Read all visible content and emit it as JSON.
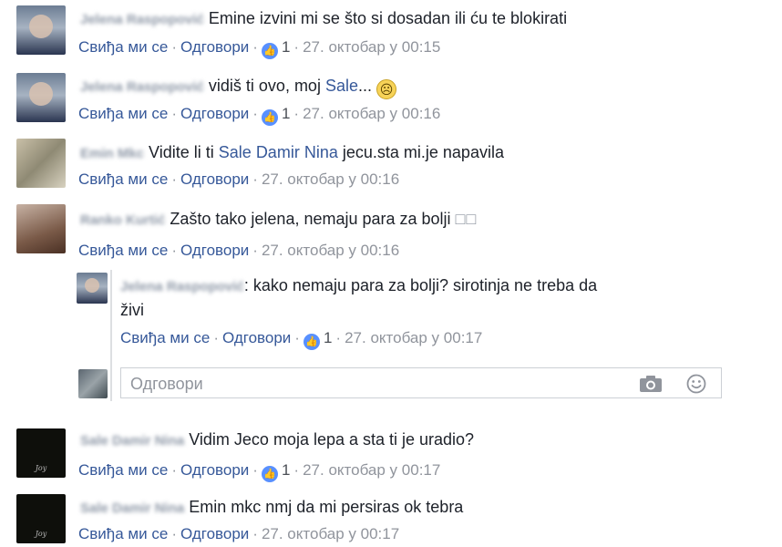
{
  "actions": {
    "like": "Свиђа ми се",
    "reply": "Одговори",
    "separator": "·"
  },
  "comments": [
    {
      "author": "Jelena Raspopović",
      "text": "Emine izvini mi se što si dosadan ili ću te blokirati",
      "likes": "1",
      "time": "27. октобар у 00:15"
    },
    {
      "author": "Jelena Raspopović",
      "text_before": "vidiš ti ovo, moj",
      "mention": "Sale",
      "text_after": "...",
      "emoji": "frown-emoji",
      "likes": "1",
      "time": "27. октобар у 00:16"
    },
    {
      "author": "Emin Mkc",
      "text_before": "Vidite li ti",
      "mentions": [
        "Sale",
        "Damir",
        "Nina"
      ],
      "text_after": "jecu.sta mi.je napavila",
      "time": "27. октобар у 00:16"
    },
    {
      "author": "Ranko Kurtić",
      "text": "Zašto tako jelena, nemaju para za bolji",
      "trailing_glyphs": "□□",
      "time": "27. октобар у 00:16"
    },
    {
      "author": "Jelena Raspopović",
      "text_line1": ": kako nemaju para za bolji? sirotinja ne treba da",
      "text_line2": "živi",
      "likes": "1",
      "time": "27. октобар у 00:17"
    },
    {
      "author": "Sale Damir Nina",
      "text": "Vidim Jeco moja lepa a sta ti je uradio?",
      "likes": "1",
      "time": "27. октобар у 00:17"
    },
    {
      "author": "Sale Damir Nina",
      "text": "Emin mkc nmj da mi persiras ok tebra",
      "time": "27. октобар у 00:17"
    }
  ],
  "reply_input": {
    "placeholder": "Одговори",
    "camera_icon": "camera-icon",
    "emoji_icon": "smiley-icon"
  },
  "colors": {
    "link": "#365899",
    "meta": "#90949c",
    "like_badge": "#5890ff"
  }
}
